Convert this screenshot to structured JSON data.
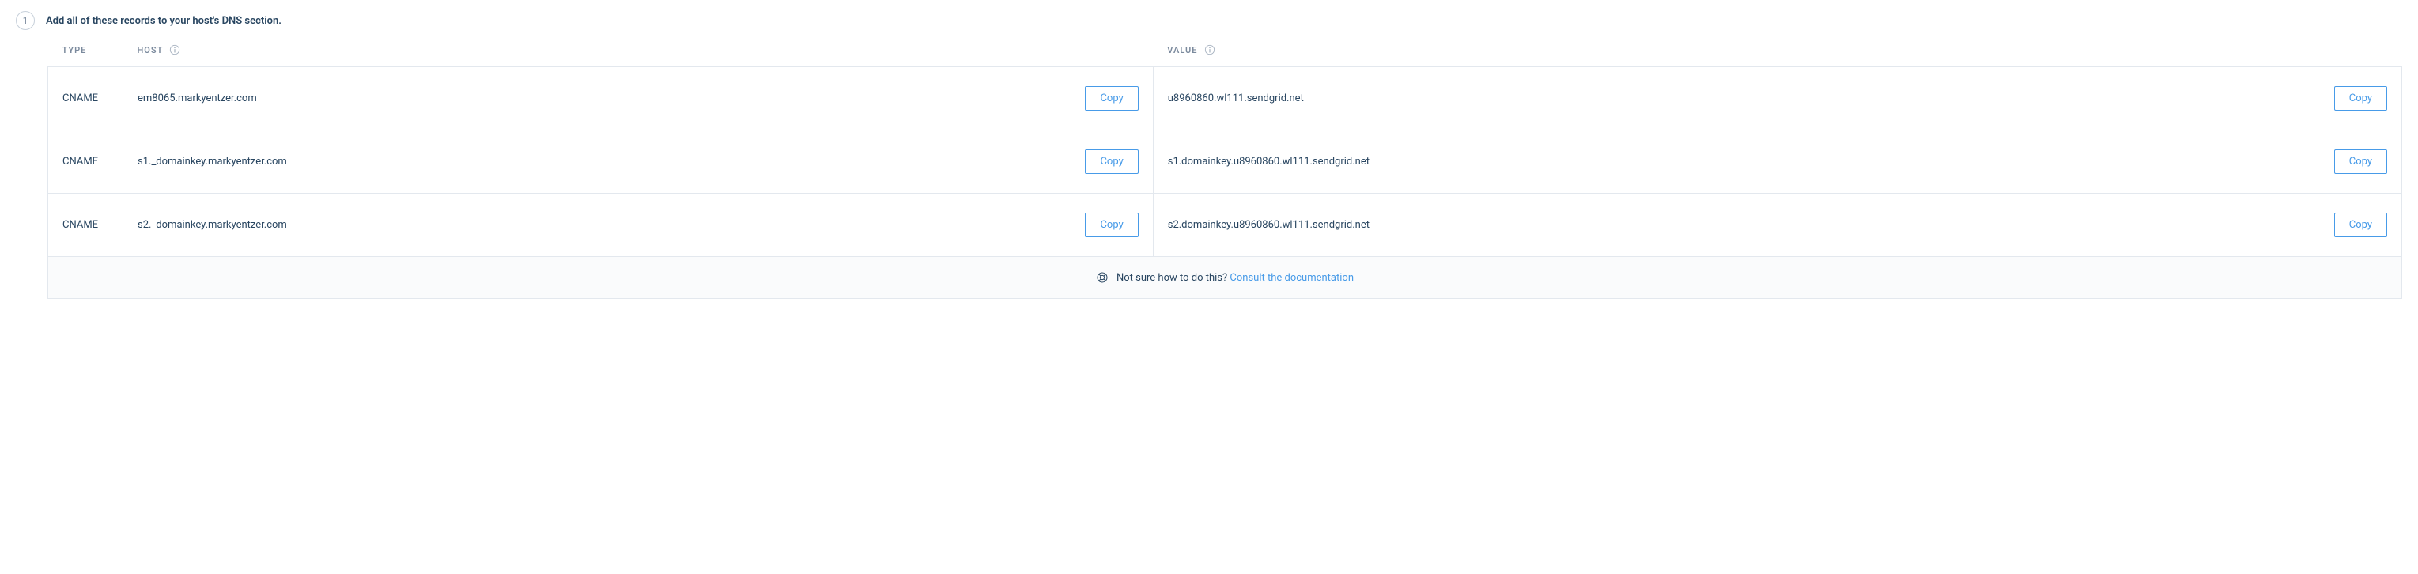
{
  "step": {
    "number": "1",
    "title": "Add all of these records to your host's DNS section."
  },
  "columns": {
    "type": "TYPE",
    "host": "HOST",
    "value": "VALUE"
  },
  "copy_label": "Copy",
  "records": [
    {
      "type": "CNAME",
      "host": "em8065.markyentzer.com",
      "value": "u8960860.wl111.sendgrid.net"
    },
    {
      "type": "CNAME",
      "host": "s1._domainkey.markyentzer.com",
      "value": "s1.domainkey.u8960860.wl111.sendgrid.net"
    },
    {
      "type": "CNAME",
      "host": "s2._domainkey.markyentzer.com",
      "value": "s2.domainkey.u8960860.wl111.sendgrid.net"
    }
  ],
  "footer": {
    "prompt": "Not sure how to do this?",
    "link": "Consult the documentation"
  }
}
